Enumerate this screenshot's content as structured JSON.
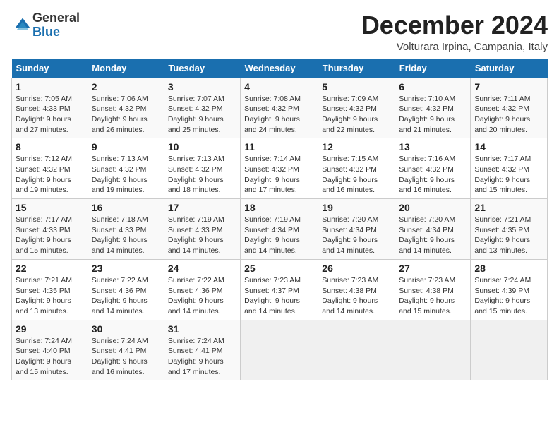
{
  "logo": {
    "general": "General",
    "blue": "Blue"
  },
  "title": "December 2024",
  "location": "Volturara Irpina, Campania, Italy",
  "headers": [
    "Sunday",
    "Monday",
    "Tuesday",
    "Wednesday",
    "Thursday",
    "Friday",
    "Saturday"
  ],
  "weeks": [
    [
      {
        "day": "1",
        "sunrise": "7:05 AM",
        "sunset": "4:33 PM",
        "daylight": "9 hours and 27 minutes."
      },
      {
        "day": "2",
        "sunrise": "7:06 AM",
        "sunset": "4:32 PM",
        "daylight": "9 hours and 26 minutes."
      },
      {
        "day": "3",
        "sunrise": "7:07 AM",
        "sunset": "4:32 PM",
        "daylight": "9 hours and 25 minutes."
      },
      {
        "day": "4",
        "sunrise": "7:08 AM",
        "sunset": "4:32 PM",
        "daylight": "9 hours and 24 minutes."
      },
      {
        "day": "5",
        "sunrise": "7:09 AM",
        "sunset": "4:32 PM",
        "daylight": "9 hours and 22 minutes."
      },
      {
        "day": "6",
        "sunrise": "7:10 AM",
        "sunset": "4:32 PM",
        "daylight": "9 hours and 21 minutes."
      },
      {
        "day": "7",
        "sunrise": "7:11 AM",
        "sunset": "4:32 PM",
        "daylight": "9 hours and 20 minutes."
      }
    ],
    [
      {
        "day": "8",
        "sunrise": "7:12 AM",
        "sunset": "4:32 PM",
        "daylight": "9 hours and 19 minutes."
      },
      {
        "day": "9",
        "sunrise": "7:13 AM",
        "sunset": "4:32 PM",
        "daylight": "9 hours and 19 minutes."
      },
      {
        "day": "10",
        "sunrise": "7:13 AM",
        "sunset": "4:32 PM",
        "daylight": "9 hours and 18 minutes."
      },
      {
        "day": "11",
        "sunrise": "7:14 AM",
        "sunset": "4:32 PM",
        "daylight": "9 hours and 17 minutes."
      },
      {
        "day": "12",
        "sunrise": "7:15 AM",
        "sunset": "4:32 PM",
        "daylight": "9 hours and 16 minutes."
      },
      {
        "day": "13",
        "sunrise": "7:16 AM",
        "sunset": "4:32 PM",
        "daylight": "9 hours and 16 minutes."
      },
      {
        "day": "14",
        "sunrise": "7:17 AM",
        "sunset": "4:32 PM",
        "daylight": "9 hours and 15 minutes."
      }
    ],
    [
      {
        "day": "15",
        "sunrise": "7:17 AM",
        "sunset": "4:33 PM",
        "daylight": "9 hours and 15 minutes."
      },
      {
        "day": "16",
        "sunrise": "7:18 AM",
        "sunset": "4:33 PM",
        "daylight": "9 hours and 14 minutes."
      },
      {
        "day": "17",
        "sunrise": "7:19 AM",
        "sunset": "4:33 PM",
        "daylight": "9 hours and 14 minutes."
      },
      {
        "day": "18",
        "sunrise": "7:19 AM",
        "sunset": "4:34 PM",
        "daylight": "9 hours and 14 minutes."
      },
      {
        "day": "19",
        "sunrise": "7:20 AM",
        "sunset": "4:34 PM",
        "daylight": "9 hours and 14 minutes."
      },
      {
        "day": "20",
        "sunrise": "7:20 AM",
        "sunset": "4:34 PM",
        "daylight": "9 hours and 14 minutes."
      },
      {
        "day": "21",
        "sunrise": "7:21 AM",
        "sunset": "4:35 PM",
        "daylight": "9 hours and 13 minutes."
      }
    ],
    [
      {
        "day": "22",
        "sunrise": "7:21 AM",
        "sunset": "4:35 PM",
        "daylight": "9 hours and 13 minutes."
      },
      {
        "day": "23",
        "sunrise": "7:22 AM",
        "sunset": "4:36 PM",
        "daylight": "9 hours and 14 minutes."
      },
      {
        "day": "24",
        "sunrise": "7:22 AM",
        "sunset": "4:36 PM",
        "daylight": "9 hours and 14 minutes."
      },
      {
        "day": "25",
        "sunrise": "7:23 AM",
        "sunset": "4:37 PM",
        "daylight": "9 hours and 14 minutes."
      },
      {
        "day": "26",
        "sunrise": "7:23 AM",
        "sunset": "4:38 PM",
        "daylight": "9 hours and 14 minutes."
      },
      {
        "day": "27",
        "sunrise": "7:23 AM",
        "sunset": "4:38 PM",
        "daylight": "9 hours and 15 minutes."
      },
      {
        "day": "28",
        "sunrise": "7:24 AM",
        "sunset": "4:39 PM",
        "daylight": "9 hours and 15 minutes."
      }
    ],
    [
      {
        "day": "29",
        "sunrise": "7:24 AM",
        "sunset": "4:40 PM",
        "daylight": "9 hours and 15 minutes."
      },
      {
        "day": "30",
        "sunrise": "7:24 AM",
        "sunset": "4:41 PM",
        "daylight": "9 hours and 16 minutes."
      },
      {
        "day": "31",
        "sunrise": "7:24 AM",
        "sunset": "4:41 PM",
        "daylight": "9 hours and 17 minutes."
      },
      null,
      null,
      null,
      null
    ]
  ],
  "labels": {
    "sunrise": "Sunrise:",
    "sunset": "Sunset:",
    "daylight": "Daylight:"
  }
}
